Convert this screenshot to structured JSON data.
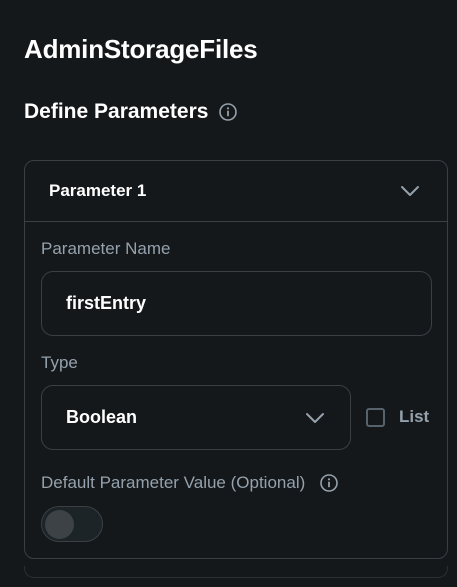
{
  "page": {
    "title": "AdminStorageFiles",
    "section_title": "Define Parameters"
  },
  "parameter": {
    "header_label": "Parameter 1",
    "name_label": "Parameter Name",
    "name_value": "firstEntry",
    "type_label": "Type",
    "type_value": "Boolean",
    "list_label": "List",
    "list_checked": false,
    "default_label": "Default Parameter Value (Optional)",
    "default_toggle_on": false
  },
  "icons": {
    "info": "info-icon",
    "expand": "chevron-down-icon"
  },
  "colors": {
    "background": "#14181b",
    "border": "#3a3f44",
    "secondary_text": "#95a1ac",
    "primary_text": "#ffffff"
  }
}
